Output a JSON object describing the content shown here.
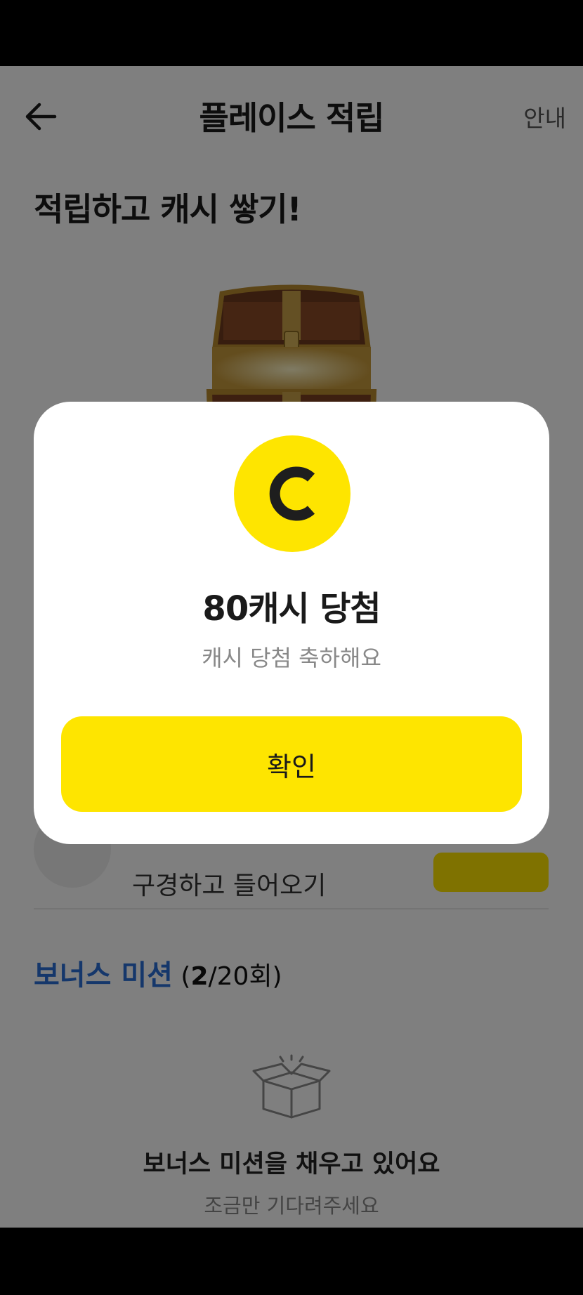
{
  "header": {
    "title": "플레이스 적립",
    "guide_label": "안내",
    "back_icon": "arrow-left-icon"
  },
  "main": {
    "heading": "적립하고 캐시 쌓기!",
    "chest_icon": "treasure-chest-icon",
    "action_text": "구경하고 들어오기",
    "bonus": {
      "title": "보너스 미션",
      "paren_open": "(",
      "count": "2",
      "total": "/20회)"
    },
    "empty_state": {
      "icon": "open-box-icon",
      "title": "보너스 미션을 채우고 있어요",
      "subtitle": "조금만 기다려주세요"
    }
  },
  "dialog": {
    "coin_letter": "C",
    "coin_color": "#fee500",
    "title": "80캐시 당첨",
    "subtitle": "캐시 당첨 축하해요",
    "confirm_label": "확인"
  },
  "colors": {
    "accent_yellow": "#fee500",
    "bonus_blue": "#2a6fd6"
  }
}
